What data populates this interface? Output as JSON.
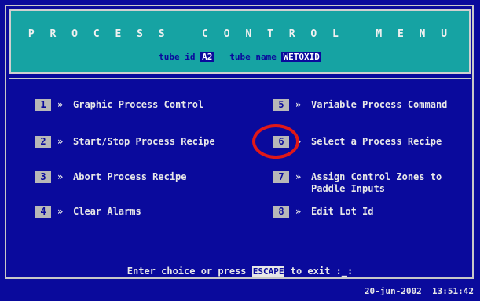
{
  "header": {
    "title": "P R O C E S S   C O N T R O L   M E N U",
    "tube_id_label": "tube id",
    "tube_id_value": "A2",
    "tube_name_label": "tube name",
    "tube_name_value": "WETOXID"
  },
  "menu": [
    {
      "key": "1",
      "label": "Graphic Process Control"
    },
    {
      "key": "2",
      "label": "Start/Stop Process Recipe"
    },
    {
      "key": "3",
      "label": "Abort Process Recipe"
    },
    {
      "key": "4",
      "label": "Clear Alarms"
    },
    {
      "key": "5",
      "label": "Variable Process Command"
    },
    {
      "key": "6",
      "label": "Select a Process Recipe"
    },
    {
      "key": "7",
      "label": "Assign Control Zones to\nPaddle Inputs"
    },
    {
      "key": "8",
      "label": "Edit Lot Id"
    }
  ],
  "arrow_glyph": "»",
  "prompt": {
    "before": "Enter choice or press",
    "key": "ESCAPE",
    "after": "to exit :_:"
  },
  "status": {
    "date": "20-jun-2002",
    "time": "13:51:42"
  },
  "colors": {
    "background": "#0a0a9c",
    "header": "#16a3a3",
    "highlight_circle": "#e01818"
  }
}
